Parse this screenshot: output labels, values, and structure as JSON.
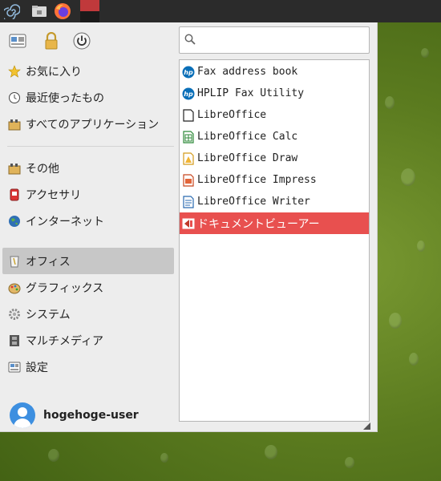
{
  "taskbar": {
    "items": [
      {
        "name": "whisker-menu-button",
        "icon": "spiral-icon"
      },
      {
        "name": "file-manager-launcher",
        "icon": "folder-icon"
      },
      {
        "name": "firefox-launcher",
        "icon": "firefox-icon"
      },
      {
        "name": "active-app-button",
        "icon": "app-square-icon"
      }
    ]
  },
  "menu": {
    "top_icons": [
      "settings-icon",
      "lock-icon",
      "power-icon"
    ],
    "search": {
      "placeholder": "",
      "value": ""
    },
    "categories": [
      {
        "label": "お気に入り",
        "icon": "star-icon"
      },
      {
        "label": "最近使ったもの",
        "icon": "clock-icon"
      },
      {
        "label": "すべてのアプリケーション",
        "icon": "applications-icon"
      },
      {
        "label": "その他",
        "icon": "other-icon"
      },
      {
        "label": "アクセサリ",
        "icon": "accessories-icon"
      },
      {
        "label": "インターネット",
        "icon": "globe-icon"
      },
      {
        "label": "オフィス",
        "icon": "office-icon",
        "selected": true
      },
      {
        "label": "グラフィックス",
        "icon": "graphics-icon"
      },
      {
        "label": "システム",
        "icon": "gear-icon"
      },
      {
        "label": "マルチメディア",
        "icon": "multimedia-icon"
      },
      {
        "label": "設定",
        "icon": "settings-icon"
      }
    ],
    "apps": [
      {
        "label": "Fax address book",
        "icon": "hp-icon"
      },
      {
        "label": "HPLIP Fax Utility",
        "icon": "hp-icon"
      },
      {
        "label": "LibreOffice",
        "icon": "libreoffice-icon"
      },
      {
        "label": "LibreOffice Calc",
        "icon": "calc-icon"
      },
      {
        "label": "LibreOffice Draw",
        "icon": "draw-icon"
      },
      {
        "label": "LibreOffice Impress",
        "icon": "impress-icon"
      },
      {
        "label": "LibreOffice Writer",
        "icon": "writer-icon"
      },
      {
        "label": "ドキュメントビューアー",
        "icon": "document-viewer-icon",
        "selected": true
      }
    ],
    "user": {
      "name": "hogehoge-user"
    }
  },
  "colors": {
    "selection": "#e8504f",
    "category_selection": "#c7c7c7",
    "desktop": "#5b7b1f",
    "taskbar": "#2b2b2b"
  }
}
